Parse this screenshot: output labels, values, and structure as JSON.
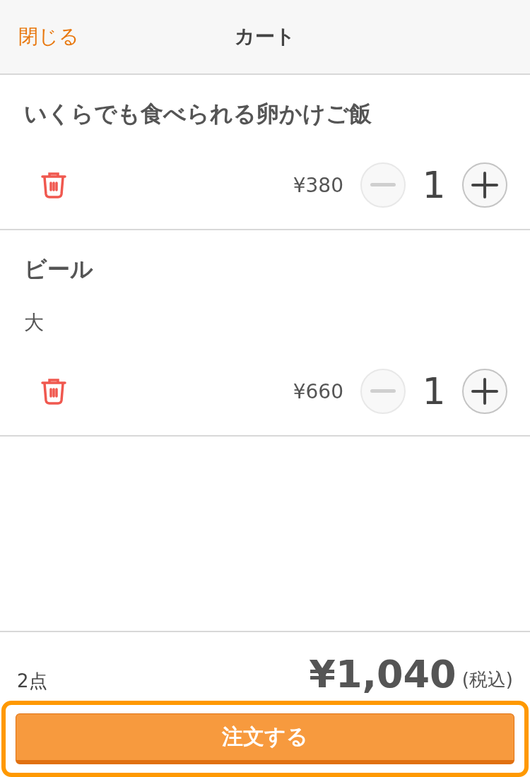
{
  "header": {
    "close": "閉じる",
    "title": "カート"
  },
  "items": [
    {
      "name": "いくらでも食べられる卵かけご飯",
      "price": "¥380",
      "quantity": "1",
      "minus_disabled": true
    },
    {
      "name": "ビール",
      "option": "大",
      "price": "¥660",
      "quantity": "1",
      "minus_disabled": true
    }
  ],
  "footer": {
    "count": "2点",
    "total": "¥1,040",
    "tax_note": "(税込)",
    "order_button": "注文する",
    "highlighted": true
  }
}
